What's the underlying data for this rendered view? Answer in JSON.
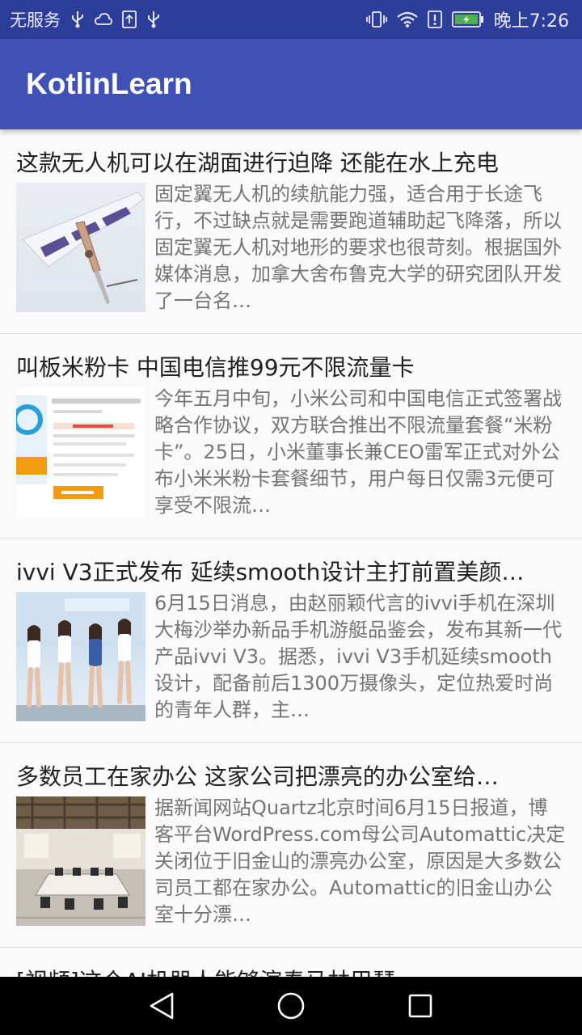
{
  "status_bar": {
    "carrier": "无服务",
    "time": "晚上7:26",
    "icons_left": [
      "usb-icon",
      "weather-icon",
      "upload-icon",
      "usb-icon"
    ],
    "icons_right": [
      "vibrate-icon",
      "wifi-icon",
      "alert-icon",
      "battery-icon"
    ]
  },
  "app_bar": {
    "title": "KotlinLearn",
    "color": "#3f51b5"
  },
  "news": [
    {
      "title": "这款无人机可以在湖面进行迫降 还能在水上充电",
      "summary": "固定翼无人机的续航能力强，适合用于长途飞行，不过缺点就是需要跑道辅助起飞降落，所以固定翼无人机对地形的要求也很苛刻。根据国外媒体消息，加拿大舍布鲁克大学的研究团队开发了一台名…",
      "image": "drone-photo"
    },
    {
      "title": "叫板米粉卡 中国电信推99元不限流量卡",
      "summary": "今年五月中旬，小米公司和中国电信正式签署战略合作协议，双方联合推出不限流量套餐“米粉卡”。25日，小米董事长兼CEO雷军正式对外公布小米米粉卡套餐细节，用户每日仅需3元便可享受不限流…",
      "image": "sim-card-page"
    },
    {
      "title": "ivvi V3正式发布 延续smooth设计主打前置美颜…",
      "summary": "6月15日消息，由赵丽颖代言的ivvi手机在深圳大梅沙举办新品手机游艇品鉴会，发布其新一代产品ivvi V3。据悉，ivvi V3手机延续smooth设计，配备前后1300万摄像头，定位热爱时尚的青年人群，主…",
      "image": "launch-event-photo"
    },
    {
      "title": "多数员工在家办公 这家公司把漂亮的办公室给…",
      "summary": "据新闻网站Quartz北京时间6月15日报道，博客平台WordPress.com母公司Automattic决定关闭位于旧金山的漂亮办公室，原因是大多数公司员工都在家办公。Automattic的旧金山办公室十分漂…",
      "image": "office-photo"
    }
  ],
  "partial_title": "[视频]这个AI机器人能够演奏马林巴琴",
  "nav_bar": {
    "back": "back-icon",
    "home": "home-icon",
    "recents": "recents-icon"
  }
}
